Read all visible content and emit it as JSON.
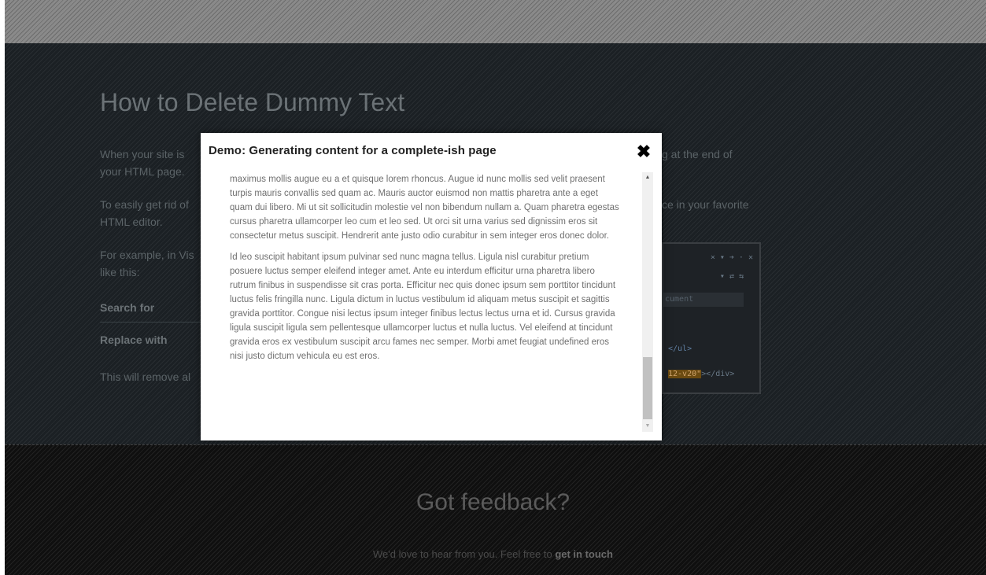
{
  "background": {
    "title": "How to Delete Dummy Text",
    "para1_left": "When your site is",
    "para1_line2": "your HTML page.",
    "para1_right": "g at the end of",
    "para2_left": "To easily get rid of",
    "para2_line2": "HTML editor.",
    "para2_right": "ce in your favorite",
    "para3_left": "For example, in Vis",
    "para3_line2": "like this:",
    "search_label": "Search for",
    "replace_label": "Replace with",
    "para4_left": "This will remove al"
  },
  "code_panel": {
    "toolbar": "× ▾ ➔ · ✕",
    "icons": "▾ ⇄ ⇆",
    "dropdown": "cument",
    "line1": "</ul>",
    "line2_hl": "12-v20\"",
    "line2_rest": "></div>"
  },
  "footer": {
    "title": "Got feedback?",
    "text": "We'd love to hear from you. Feel free to",
    "link": "get in touch"
  },
  "modal": {
    "title": "Demo: Generating content for a complete-ish page",
    "close_glyph": "✖",
    "paragraph1": "maximus mollis augue eu a et quisque lorem rhoncus. Augue id nunc mollis sed velit praesent turpis mauris convallis sed quam ac. Mauris auctor euismod non mattis pharetra ante a eget quam dui libero. Mi ut sit sollicitudin molestie vel non bibendum nullam a. Quam pharetra egestas cursus pharetra ullamcorper leo cum et leo sed. Ut orci sit urna varius sed dignissim eros sit consectetur metus suscipit. Hendrerit ante justo odio curabitur in sem integer eros donec dolor.",
    "paragraph2": "Id leo suscipit habitant ipsum pulvinar sed nunc magna tellus. Ligula nisl curabitur pretium posuere luctus semper eleifend integer amet. Ante eu interdum efficitur urna pharetra libero rutrum finibus in suspendisse sit cras porta. Efficitur nec quis donec ipsum sem porttitor tincidunt luctus felis fringilla nunc. Ligula dictum in luctus vestibulum id aliquam metus suscipit et sagittis gravida porttitor. Congue nisi lectus ipsum integer finibus lectus lectus urna et id. Cursus gravida ligula suscipit ligula sem pellentesque ullamcorper luctus et nulla luctus. Vel eleifend at tincidunt gravida eros ex vestibulum suscipit arcu fames nec semper. Morbi amet feugiat undefined eros nisi justo dictum vehicula eu est eros."
  },
  "icons": {
    "close": "close-icon",
    "scroll_up": "chevron-up-icon",
    "scroll_down": "chevron-down-icon"
  }
}
